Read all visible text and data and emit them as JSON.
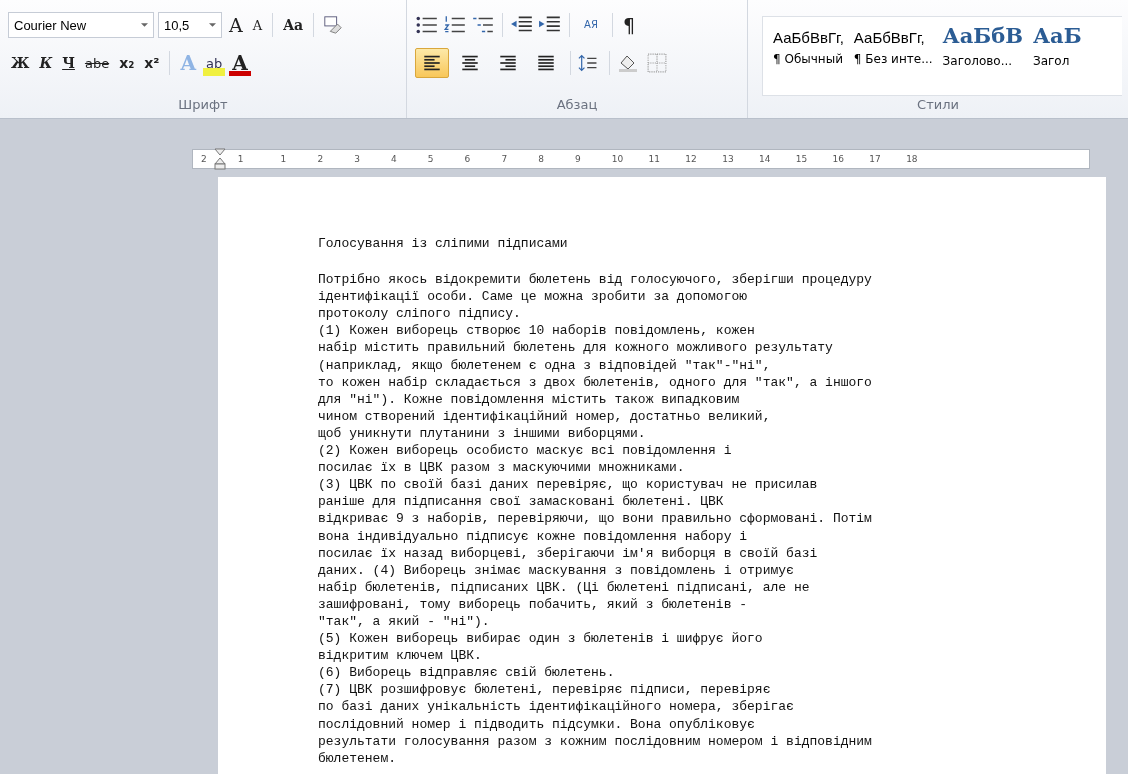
{
  "ribbon": {
    "font_group": {
      "font_name": "Courier New",
      "font_size": "10,5",
      "grow_label": "A",
      "shrink_label": "A",
      "case_label": "Aa",
      "bold_label": "Ж",
      "italic_label": "К",
      "underline_label": "Ч",
      "strike_label": "abe",
      "subscript_label": "x₂",
      "superscript_label": "x²",
      "effects_label": "A",
      "highlight_label": "ab",
      "color_label": "A",
      "label": "Шрифт"
    },
    "paragraph_group": {
      "pilcrow": "¶",
      "sort_label": "АЯ",
      "align_buttons": [
        {
          "selected": true
        },
        {
          "selected": false
        },
        {
          "selected": false
        },
        {
          "selected": false
        }
      ],
      "label": "Абзац"
    },
    "styles_group": {
      "label": "Стили",
      "styles": [
        {
          "kind": "normal",
          "preview": "АаБбВвГг,",
          "name": "¶ Обычный"
        },
        {
          "kind": "normal",
          "preview": "АаБбВвГг,",
          "name": "¶ Без инте..."
        },
        {
          "kind": "heading",
          "preview": "АаБбВ",
          "name": "Заголово..."
        },
        {
          "kind": "heading",
          "preview": "АаБ",
          "name": "Загол"
        }
      ]
    }
  },
  "ruler": {
    "labels": [
      "2",
      "1",
      "1",
      "2",
      "3",
      "4",
      "5",
      "6",
      "7",
      "8",
      "9",
      "10",
      "11",
      "12",
      "13",
      "14",
      "15",
      "16",
      "17",
      "18"
    ]
  },
  "document": {
    "title": "Голосування із сліпими підписами",
    "lines": [
      "Потрібно якось відокремити бюлетень від голосуючого, зберігши процедуру",
      "ідентифікації особи. Саме це можна зробити за допомогою",
      "протоколу сліпого підпису.",
      "(1) Кожен виборець створює 10 наборів повідомлень, кожен",
      "набір містить правильний бюлетень для кожного можливого результату",
      "(наприклад, якщо бюлетенем є одна з відповідей \"так\"-\"ні\",",
      "то кожен набір складається з двох бюлетенів, одного для \"так\", а іншого",
      "для \"ні\"). Кожне повідомлення містить також випадковим",
      "чином створений ідентифікаційний номер, достатньо великий,",
      "щоб уникнути плутанини з іншими виборцями.",
      "(2) Кожен виборець особисто маскує всі повідомлення і",
      "посилає їх в ЦВК разом з маскуючими множниками.",
      "(3) ЦВК по своїй базі даних перевіряє, що користувач не присилав",
      "раніше для підписання свої замасковані бюлетені. ЦВК",
      "відкриває 9 з наборів, перевіряючи, що вони правильно сформовані. Потім",
      "вона індивідуально підписує кожне повідомлення набору і",
      "посилає їх назад виборцеві, зберігаючи ім'я виборця в своїй базі",
      "даних. (4) Виборець знімає маскування з повідомлень і отримує",
      "набір бюлетенів, підписаних ЦВК. (Ці бюлетені підписані, але не",
      "зашифровані, тому виборець побачить, який з бюлетенів -",
      "\"так\", а який - \"ні\").",
      "(5) Кожен виборець вибирає один з бюлетенів і шифрує його",
      "відкритим ключем ЦВК.",
      "(6) Виборець відправляє свій бюлетень.",
      "(7) ЦВК розшифровує бюлетені, перевіряє підписи, перевіряє",
      "по базі даних унікальність ідентифікаційного номера, зберігає",
      "послідовний номер і підводить підсумки. Вона опубліковує",
      "результати голосування разом з кожним послідовним номером і відповідним",
      "бюлетенем."
    ]
  }
}
